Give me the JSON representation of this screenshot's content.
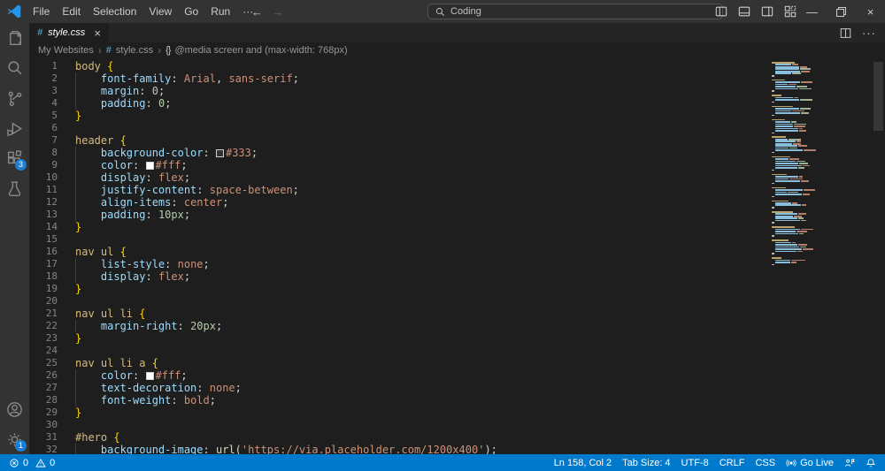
{
  "titlebar": {
    "menus": [
      "File",
      "Edit",
      "Selection",
      "View",
      "Go",
      "Run",
      "···"
    ],
    "search_label": "Coding"
  },
  "glyphs": {
    "back_arrow": "←",
    "forward_arrow": "→",
    "minimize": "—",
    "close": "×",
    "chevron": "›",
    "hash": "#",
    "braces": "{}",
    "more_dots": "···",
    "tab_close": "×"
  },
  "activity_bar": {
    "extensions_badge": "3",
    "settings_badge": "1"
  },
  "tab": {
    "file_name": "style.css"
  },
  "breadcrumb": {
    "folder": "My Websites",
    "file": "style.css",
    "symbol": "@media screen and (max-width: 768px)"
  },
  "editor": {
    "lines": [
      {
        "n": 1,
        "tokens": [
          [
            "sel",
            "body"
          ],
          [
            "p",
            " "
          ],
          [
            "brace",
            "{"
          ]
        ]
      },
      {
        "n": 2,
        "tokens": [
          [
            "p",
            "    "
          ],
          [
            "prop",
            "font-family"
          ],
          [
            "punc",
            ":"
          ],
          [
            "p",
            " "
          ],
          [
            "val",
            "Arial"
          ],
          [
            "punc",
            ","
          ],
          [
            "p",
            " "
          ],
          [
            "val",
            "sans-serif"
          ],
          [
            "punc",
            ";"
          ]
        ]
      },
      {
        "n": 3,
        "tokens": [
          [
            "p",
            "    "
          ],
          [
            "prop",
            "margin"
          ],
          [
            "punc",
            ":"
          ],
          [
            "p",
            " "
          ],
          [
            "num",
            "0"
          ],
          [
            "punc",
            ";"
          ]
        ]
      },
      {
        "n": 4,
        "tokens": [
          [
            "p",
            "    "
          ],
          [
            "prop",
            "padding"
          ],
          [
            "punc",
            ":"
          ],
          [
            "p",
            " "
          ],
          [
            "num",
            "0"
          ],
          [
            "punc",
            ";"
          ]
        ]
      },
      {
        "n": 5,
        "tokens": [
          [
            "brace",
            "}"
          ]
        ]
      },
      {
        "n": 6,
        "tokens": []
      },
      {
        "n": 7,
        "tokens": [
          [
            "sel",
            "header"
          ],
          [
            "p",
            " "
          ],
          [
            "brace",
            "{"
          ]
        ]
      },
      {
        "n": 8,
        "tokens": [
          [
            "p",
            "    "
          ],
          [
            "prop",
            "background-color"
          ],
          [
            "punc",
            ":"
          ],
          [
            "p",
            " "
          ],
          [
            "sw",
            "#333333"
          ],
          [
            "val",
            "#333"
          ],
          [
            "punc",
            ";"
          ]
        ]
      },
      {
        "n": 9,
        "tokens": [
          [
            "p",
            "    "
          ],
          [
            "prop",
            "color"
          ],
          [
            "punc",
            ":"
          ],
          [
            "p",
            " "
          ],
          [
            "sw",
            "#ffffff"
          ],
          [
            "val",
            "#fff"
          ],
          [
            "punc",
            ";"
          ]
        ]
      },
      {
        "n": 10,
        "tokens": [
          [
            "p",
            "    "
          ],
          [
            "prop",
            "display"
          ],
          [
            "punc",
            ":"
          ],
          [
            "p",
            " "
          ],
          [
            "val",
            "flex"
          ],
          [
            "punc",
            ";"
          ]
        ]
      },
      {
        "n": 11,
        "tokens": [
          [
            "p",
            "    "
          ],
          [
            "prop",
            "justify-content"
          ],
          [
            "punc",
            ":"
          ],
          [
            "p",
            " "
          ],
          [
            "val",
            "space-between"
          ],
          [
            "punc",
            ";"
          ]
        ]
      },
      {
        "n": 12,
        "tokens": [
          [
            "p",
            "    "
          ],
          [
            "prop",
            "align-items"
          ],
          [
            "punc",
            ":"
          ],
          [
            "p",
            " "
          ],
          [
            "val",
            "center"
          ],
          [
            "punc",
            ";"
          ]
        ]
      },
      {
        "n": 13,
        "tokens": [
          [
            "p",
            "    "
          ],
          [
            "prop",
            "padding"
          ],
          [
            "punc",
            ":"
          ],
          [
            "p",
            " "
          ],
          [
            "num",
            "10px"
          ],
          [
            "punc",
            ";"
          ]
        ]
      },
      {
        "n": 14,
        "tokens": [
          [
            "brace",
            "}"
          ]
        ]
      },
      {
        "n": 15,
        "tokens": []
      },
      {
        "n": 16,
        "tokens": [
          [
            "sel",
            "nav ul"
          ],
          [
            "p",
            " "
          ],
          [
            "brace",
            "{"
          ]
        ]
      },
      {
        "n": 17,
        "tokens": [
          [
            "p",
            "    "
          ],
          [
            "prop",
            "list-style"
          ],
          [
            "punc",
            ":"
          ],
          [
            "p",
            " "
          ],
          [
            "val",
            "none"
          ],
          [
            "punc",
            ";"
          ]
        ]
      },
      {
        "n": 18,
        "tokens": [
          [
            "p",
            "    "
          ],
          [
            "prop",
            "display"
          ],
          [
            "punc",
            ":"
          ],
          [
            "p",
            " "
          ],
          [
            "val",
            "flex"
          ],
          [
            "punc",
            ";"
          ]
        ]
      },
      {
        "n": 19,
        "tokens": [
          [
            "brace",
            "}"
          ]
        ]
      },
      {
        "n": 20,
        "tokens": []
      },
      {
        "n": 21,
        "tokens": [
          [
            "sel",
            "nav ul li"
          ],
          [
            "p",
            " "
          ],
          [
            "brace",
            "{"
          ]
        ]
      },
      {
        "n": 22,
        "tokens": [
          [
            "p",
            "    "
          ],
          [
            "prop",
            "margin-right"
          ],
          [
            "punc",
            ":"
          ],
          [
            "p",
            " "
          ],
          [
            "num",
            "20px"
          ],
          [
            "punc",
            ";"
          ]
        ]
      },
      {
        "n": 23,
        "tokens": [
          [
            "brace",
            "}"
          ]
        ]
      },
      {
        "n": 24,
        "tokens": []
      },
      {
        "n": 25,
        "tokens": [
          [
            "sel",
            "nav ul li a"
          ],
          [
            "p",
            " "
          ],
          [
            "brace",
            "{"
          ]
        ]
      },
      {
        "n": 26,
        "tokens": [
          [
            "p",
            "    "
          ],
          [
            "prop",
            "color"
          ],
          [
            "punc",
            ":"
          ],
          [
            "p",
            " "
          ],
          [
            "sw",
            "#ffffff"
          ],
          [
            "val",
            "#fff"
          ],
          [
            "punc",
            ";"
          ]
        ]
      },
      {
        "n": 27,
        "tokens": [
          [
            "p",
            "    "
          ],
          [
            "prop",
            "text-decoration"
          ],
          [
            "punc",
            ":"
          ],
          [
            "p",
            " "
          ],
          [
            "val",
            "none"
          ],
          [
            "punc",
            ";"
          ]
        ]
      },
      {
        "n": 28,
        "tokens": [
          [
            "p",
            "    "
          ],
          [
            "prop",
            "font-weight"
          ],
          [
            "punc",
            ":"
          ],
          [
            "p",
            " "
          ],
          [
            "val",
            "bold"
          ],
          [
            "punc",
            ";"
          ]
        ]
      },
      {
        "n": 29,
        "tokens": [
          [
            "brace",
            "}"
          ]
        ]
      },
      {
        "n": 30,
        "tokens": []
      },
      {
        "n": 31,
        "tokens": [
          [
            "sel",
            "#hero"
          ],
          [
            "p",
            " "
          ],
          [
            "brace",
            "{"
          ]
        ]
      },
      {
        "n": 32,
        "tokens": [
          [
            "p",
            "    "
          ],
          [
            "prop",
            "background-image"
          ],
          [
            "punc",
            ":"
          ],
          [
            "p",
            " "
          ],
          [
            "fn",
            "url"
          ],
          [
            "punc",
            "("
          ],
          [
            "str",
            "'https://via.placeholder.com/1200x400'"
          ],
          [
            "punc",
            ")"
          ],
          [
            "punc",
            ";"
          ]
        ]
      }
    ]
  },
  "status_bar": {
    "errors": "0",
    "warnings": "0",
    "cursor": "Ln 158, Col 2",
    "tab_size": "Tab Size: 4",
    "encoding": "UTF-8",
    "eol": "CRLF",
    "language": "CSS",
    "go_live": "Go Live"
  },
  "colors": {
    "accent": "#007acc",
    "badge": "#1a7fd4",
    "css_icon": "#519aba",
    "token_selector": "#d7ba7d",
    "token_property": "#9cdcfe",
    "token_value": "#ce9178",
    "token_number": "#b5cea8",
    "token_brace": "#ffd700",
    "token_function": "#dcdcaa",
    "token_plain": "#d4d4d4"
  }
}
